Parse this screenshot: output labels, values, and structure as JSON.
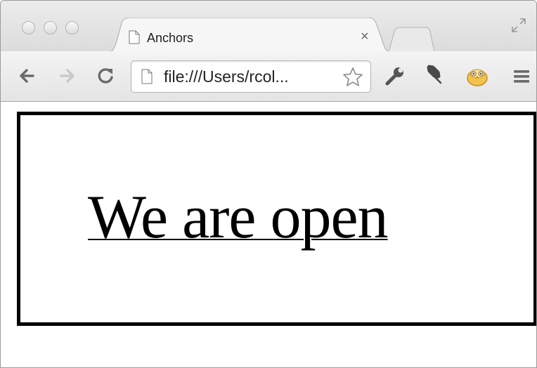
{
  "browser": {
    "tab": {
      "title": "Anchors",
      "close_glyph": "×",
      "icon": "page-icon"
    },
    "address_bar": {
      "url": "file:///Users/rcol...",
      "page_icon": "page-icon",
      "bookmark_icon": "star-icon"
    },
    "toolbar": {
      "back_icon": "back-arrow-icon",
      "forward_icon": "forward-arrow-icon",
      "reload_icon": "reload-icon",
      "extensions": [
        "wrench-icon",
        "pin-icon",
        "owl-icon"
      ],
      "menu_icon": "menu-icon"
    }
  },
  "page": {
    "link_text": "We are open",
    "border_color": "#000000"
  }
}
